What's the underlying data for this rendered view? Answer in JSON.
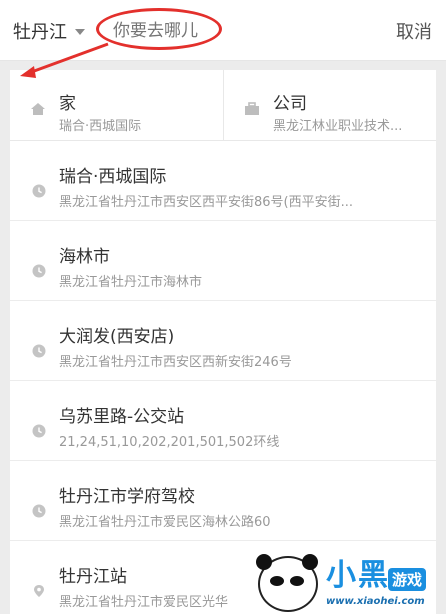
{
  "header": {
    "city": "牡丹江",
    "search_placeholder": "你要去哪儿",
    "cancel_label": "取消"
  },
  "quick_places": {
    "home": {
      "title": "家",
      "subtitle": "瑞合·西城国际"
    },
    "work": {
      "title": "公司",
      "subtitle": "黑龙江林业职业技术..."
    }
  },
  "history": [
    {
      "title": "瑞合·西城国际",
      "subtitle": "黑龙江省牡丹江市西安区西平安街86号(西平安街...",
      "icon": "clock-icon"
    },
    {
      "title": "海林市",
      "subtitle": "黑龙江省牡丹江市海林市",
      "icon": "clock-icon"
    },
    {
      "title": "大润发(西安店)",
      "subtitle": "黑龙江省牡丹江市西安区西新安街246号",
      "icon": "clock-icon"
    },
    {
      "title": "乌苏里路-公交站",
      "subtitle": "21,24,51,10,202,201,501,502环线",
      "icon": "clock-icon"
    },
    {
      "title": "牡丹江市学府驾校",
      "subtitle": "黑龙江省牡丹江市爱民区海林公路60",
      "icon": "clock-icon"
    },
    {
      "title": "牡丹江站",
      "subtitle": "黑龙江省牡丹江市爱民区光华",
      "icon": "pin-icon"
    }
  ],
  "watermark": {
    "brand": "小黑",
    "tag": "游戏",
    "url": "www.xiaohei.com"
  },
  "colors": {
    "annotation_red": "#e3302c",
    "watermark_blue": "#1a8fe0"
  }
}
